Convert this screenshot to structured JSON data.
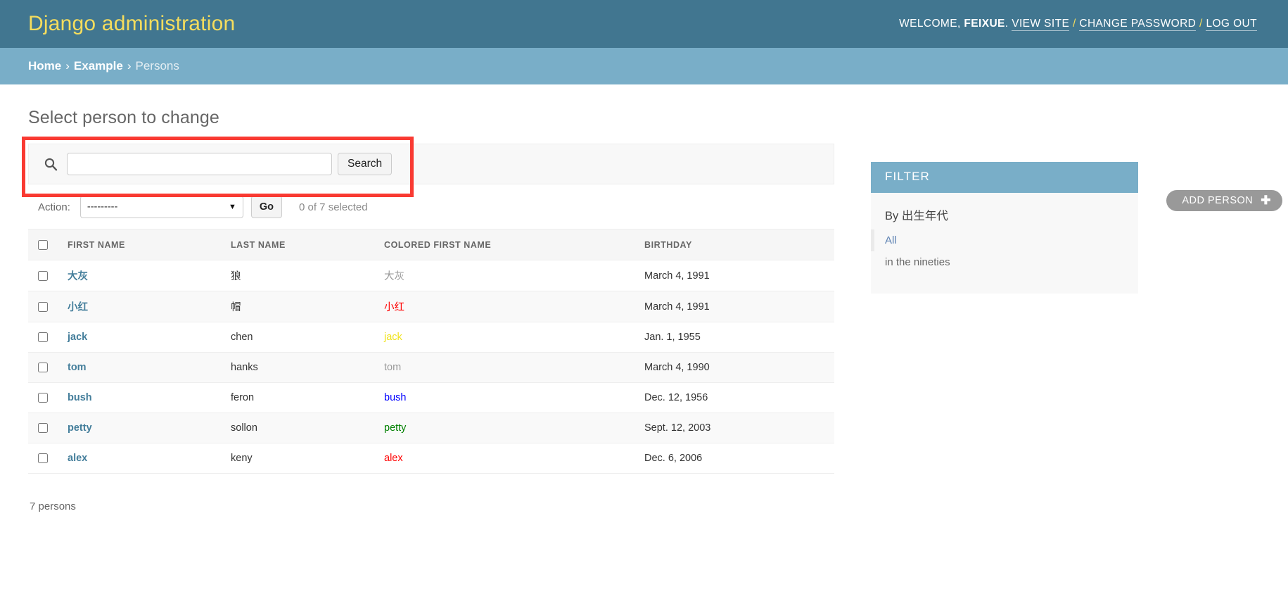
{
  "header": {
    "site_title": "Django administration",
    "welcome_prefix": "WELCOME,",
    "username": "FEIXUE",
    "welcome_suffix": ".",
    "view_site": "VIEW SITE",
    "change_password": "CHANGE PASSWORD",
    "log_out": "LOG OUT",
    "separator": "/",
    "bg_color": "#417690",
    "title_color": "#f5dd5d"
  },
  "breadcrumbs": {
    "items": [
      {
        "label": "Home",
        "current": false
      },
      {
        "label": "Example",
        "current": false
      },
      {
        "label": "Persons",
        "current": true
      }
    ],
    "separator": "›",
    "bg_color": "#79aec8"
  },
  "page": {
    "title": "Select person to change",
    "add_button_label": "ADD PERSON",
    "add_button_icon": "plus-icon",
    "add_button_color": "#999999"
  },
  "search": {
    "icon": "search-icon",
    "value": "",
    "placeholder": "",
    "submit_label": "Search",
    "highlight_color": "#f93a32",
    "highlighted": true
  },
  "actions": {
    "label": "Action:",
    "selected_option": "---------",
    "options": [
      "---------"
    ],
    "caret_icon": "chevron-down-icon",
    "go_label": "Go",
    "counter": "0 of 7 selected"
  },
  "table": {
    "select_all_label": "select-all-checkbox",
    "columns": [
      {
        "key": "first_name",
        "label": "FIRST NAME"
      },
      {
        "key": "last_name",
        "label": "LAST NAME"
      },
      {
        "key": "colored_first_name",
        "label": "COLORED FIRST NAME"
      },
      {
        "key": "birthday",
        "label": "BIRTHDAY"
      }
    ],
    "rows": [
      {
        "first_name": "大灰",
        "last_name": "狼",
        "colored_first_name": "大灰",
        "color": "#999999",
        "birthday": "March 4, 1991"
      },
      {
        "first_name": "小红",
        "last_name": "帽",
        "colored_first_name": "小红",
        "color": "#ff0000",
        "birthday": "March 4, 1991"
      },
      {
        "first_name": "jack",
        "last_name": "chen",
        "colored_first_name": "jack",
        "color": "#f0e31c",
        "birthday": "Jan. 1, 1955"
      },
      {
        "first_name": "tom",
        "last_name": "hanks",
        "colored_first_name": "tom",
        "color": "#999999",
        "birthday": "March 4, 1990"
      },
      {
        "first_name": "bush",
        "last_name": "feron",
        "colored_first_name": "bush",
        "color": "#0000ff",
        "birthday": "Dec. 12, 1956"
      },
      {
        "first_name": "petty",
        "last_name": "sollon",
        "colored_first_name": "petty",
        "color": "#008000",
        "birthday": "Sept. 12, 2003"
      },
      {
        "first_name": "alex",
        "last_name": "keny",
        "colored_first_name": "alex",
        "color": "#ff0000",
        "birthday": "Dec. 6, 2006"
      }
    ],
    "result_count": "7 persons"
  },
  "filter": {
    "title": "FILTER",
    "groups": [
      {
        "heading": "By 出生年代",
        "choices": [
          {
            "label": "All",
            "selected": true
          },
          {
            "label": "in the nineties",
            "selected": false
          }
        ]
      }
    ]
  }
}
